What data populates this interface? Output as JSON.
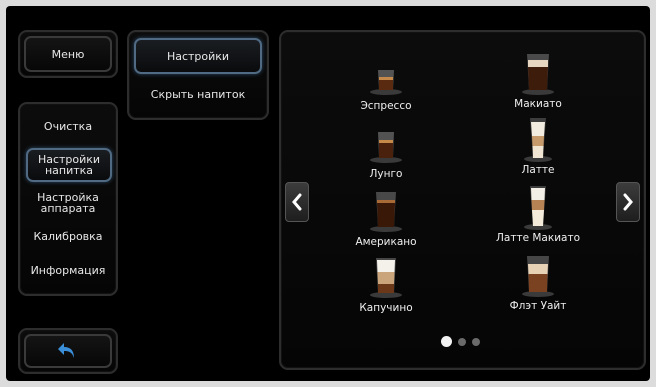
{
  "menu": {
    "label": "Меню"
  },
  "sidebar": {
    "items": [
      {
        "label": "Очистка"
      },
      {
        "label": "Настройки\nнапитка"
      },
      {
        "label": "Настройка\nаппарата"
      },
      {
        "label": "Калибровка"
      },
      {
        "label": "Информация"
      }
    ],
    "back_icon": "undo-arrow-icon"
  },
  "submenu": {
    "items": [
      {
        "label": "Настройки"
      },
      {
        "label": "Скрыть напиток"
      }
    ]
  },
  "drinks": [
    {
      "label": "Эспрессо"
    },
    {
      "label": "Макиато"
    },
    {
      "label": "Лунго"
    },
    {
      "label": "Латте"
    },
    {
      "label": "Американо"
    },
    {
      "label": "Латте Макиато"
    },
    {
      "label": "Капучино"
    },
    {
      "label": "Флэт Уайт"
    }
  ],
  "pagination": {
    "pages": 3,
    "current": 1
  },
  "colors": {
    "accent": "#4f6a82",
    "back_arrow": "#3b8fd9",
    "background": "#000000"
  }
}
